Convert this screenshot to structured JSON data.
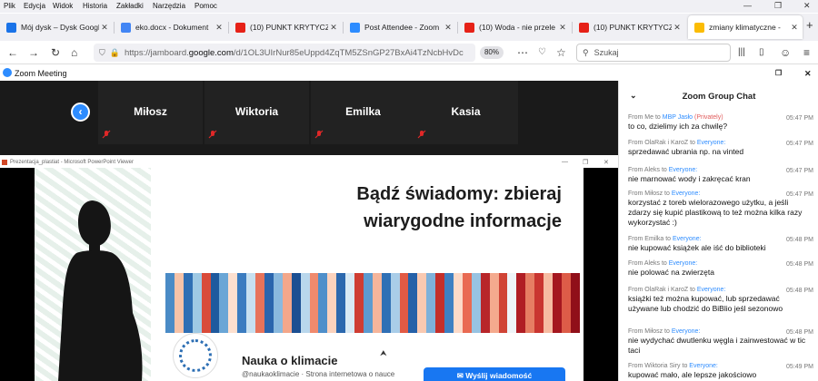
{
  "menubar": {
    "items": [
      "Plik",
      "Edycja",
      "Widok",
      "Historia",
      "Zakładki",
      "Narzędzia",
      "Pomoc"
    ]
  },
  "tabs": [
    {
      "title": "Mój dysk – Dysk Googl",
      "color": "#1a73e8"
    },
    {
      "title": "eko.docx - Dokument",
      "color": "#4285f4"
    },
    {
      "title": "(10) PUNKT KRYTYCZ",
      "color": "#e62117"
    },
    {
      "title": "Post Attendee - Zoom",
      "color": "#2d8cff"
    },
    {
      "title": "(10) Woda - nie przele",
      "color": "#e62117"
    },
    {
      "title": "(10) PUNKT KRYTYCZ",
      "color": "#e62117"
    },
    {
      "title": "zmiany klimatyczne -",
      "color": "#fbbc04"
    }
  ],
  "navbar": {
    "url_pre": "https://jamboard.",
    "url_domain": "google.com",
    "url_post": "/d/1OL3UIrNur85eUppd4ZqTM5ZSnGP27BxAi4TzNcbHvDc",
    "zoom": "80%",
    "search_placeholder": "Szukaj"
  },
  "zoom": {
    "window_title": "Zoom Meeting",
    "participants": [
      "Miłosz",
      "Wiktoria",
      "Emilka",
      "Kasia"
    ]
  },
  "ppt": {
    "window_title": "Prezentacja_plastiat - Microsoft PowerPoint Viewer",
    "title_line1": "Bądź świadomy: zbieraj",
    "title_line2": "wiarygodne informacje",
    "card_title": "Nauka o klimacie",
    "card_sub": "@naukaoklimacie · Strona internetowa o nauce",
    "card_button": "Wyślij wiadomość",
    "stripe_colors": [
      "#4a8bc6",
      "#f6c3a8",
      "#2f6fb4",
      "#9ec9e4",
      "#d94b3a",
      "#1f5a9e",
      "#6aa6d6",
      "#fde0cf",
      "#3b7cc0",
      "#c7e0f0",
      "#e7735a",
      "#2a65ad",
      "#8ab9de",
      "#f3a78a",
      "#1c4f92",
      "#b9d7ec",
      "#f08a6d",
      "#4f8fca",
      "#fbd2bd",
      "#2b68ae",
      "#d8e9f4",
      "#cf3d32",
      "#5c9bd0",
      "#f5b59b",
      "#3070b5",
      "#a9cde8",
      "#e25a44",
      "#2561a8",
      "#f9c9b1",
      "#7eb1da",
      "#c42f2a",
      "#3d80c2",
      "#fcdac8",
      "#e96a52",
      "#98c3e2",
      "#b8262a",
      "#f4aa8e",
      "#d04436",
      "#eef4f8",
      "#b01d24",
      "#e67d63",
      "#c93530",
      "#f6bca2",
      "#a5171f",
      "#dd5c48",
      "#900f19"
    ]
  },
  "chat": {
    "title": "Zoom Group Chat",
    "messages": [
      {
        "pre": "From Me to ",
        "who": "MBP Jasło",
        "priv": " (Privately)",
        "time": "05:47 PM",
        "text": "to co, dzielimy ich za chwilę?"
      },
      {
        "pre": "From OlaRak i KaroZ to ",
        "who": "Everyone:",
        "priv": "",
        "time": "05:47 PM",
        "text": "sprzedawać ubrania np. na vinted"
      },
      {
        "pre": "From Aleks to ",
        "who": "Everyone:",
        "priv": "",
        "time": "05:47 PM",
        "text": "nie marnować wody i zakręcać kran"
      },
      {
        "pre": "From Miłosz to ",
        "who": "Everyone:",
        "priv": "",
        "time": "05:47 PM",
        "text": "korzystać z toreb wielorazowego użytku, a jeśli zdarzy się kupić plastikową to też można kilka razy wykorzystać :)"
      },
      {
        "pre": "From Emilka to ",
        "who": "Everyone:",
        "priv": "",
        "time": "05:48 PM",
        "text": "nie kupować książek ale iść do biblioteki"
      },
      {
        "pre": "From Aleks to ",
        "who": "Everyone:",
        "priv": "",
        "time": "05:48 PM",
        "text": "nie polować na zwierzęta"
      },
      {
        "pre": "From OlaRak i KaroZ to ",
        "who": "Everyone:",
        "priv": "",
        "time": "05:48 PM",
        "text": "książki też można kupować, lub sprzedawać używane lub chodzić do BiBlio jeśl sezonowo"
      },
      {
        "pre": "From Miłosz to ",
        "who": "Everyone:",
        "priv": "",
        "time": "05:48 PM",
        "text": "nie wydychać dwutlenku węgla i zainwestować w tic taci"
      },
      {
        "pre": "From Wiktoria Siry to ",
        "who": "Everyone:",
        "priv": "",
        "time": "05:49 PM",
        "text": "kupować mało, ale lepsze jakościowo"
      }
    ]
  }
}
